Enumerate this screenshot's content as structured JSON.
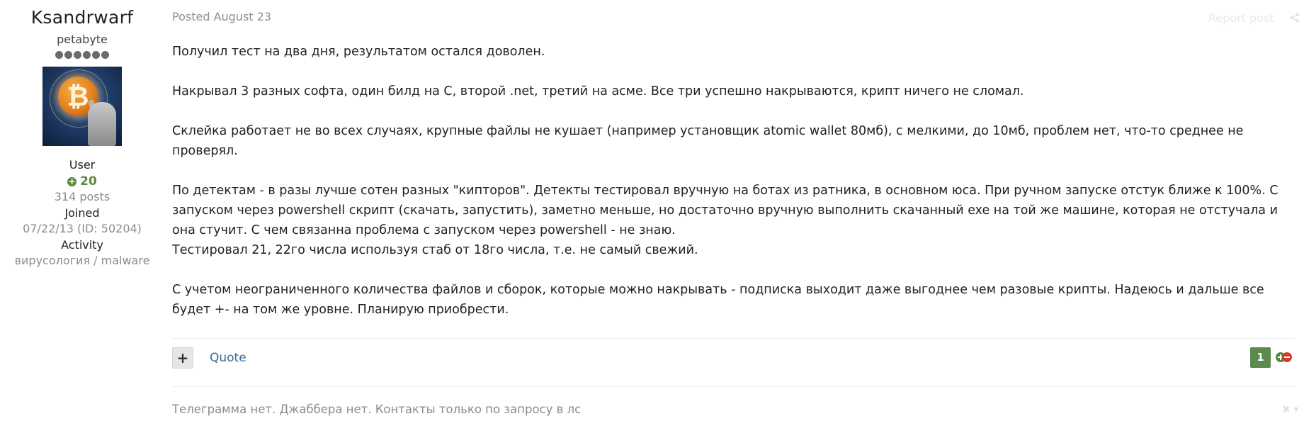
{
  "author": {
    "name": "Ksandrwarf",
    "rank_title": "petabyte",
    "rank_pips": 6,
    "group": "User",
    "reputation": "20",
    "post_count": "314 posts",
    "joined_label": "Joined",
    "joined_value": "07/22/13 (ID: 50204)",
    "activity_label": "Activity",
    "activity_value": "вирусология / malware"
  },
  "post": {
    "date": "Posted August 23",
    "report_label": "Report post",
    "paragraphs": [
      "Получил тест на два дня, результатом остался доволен.",
      "Накрывал 3 разных софта, один билд на С, второй .net, третий на асме. Все три успешно накрываются, крипт ничего не сломал.",
      "Склейка работает не во всех случаях, крупные файлы не кушает (например установщик atomic wallet 80мб), с мелкими, до 10мб, проблем нет, что-то среднее не проверял.",
      "По детектам - в разы лучше сотен разных \"кипторов\". Детекты тестировал вручную на ботах из ратника, в основном юса. При ручном запуске отстук ближе к 100%. С запуском через powershell скрипт (скачать, запустить), заметно меньше, но достаточно вручную выполнить скачанный exe на той же машине, которая не отстучала и она стучит. С чем связанна проблема с запуском через powershell - не знаю.",
      "Тестировал 21, 22го числа используя стаб от 18го числа, т.е. не самый свежий.",
      "С учетом неограниченного количества файлов и сборок, которые можно накрывать - подписка выходит даже выгоднее чем разовые крипты. Надеюсь и дальше все будет +- на том же уровне. Планирую приобрести."
    ],
    "quote_label": "Quote",
    "multiquote_label": "+",
    "reaction_count": "1",
    "signature": "Телеграмма нет. Джаббера нет. Контакты только по запросу в лс"
  },
  "colors": {
    "reputation": "#5a8a3c",
    "link": "#3d6a9e",
    "reaction_badge": "#5b8a4c"
  }
}
